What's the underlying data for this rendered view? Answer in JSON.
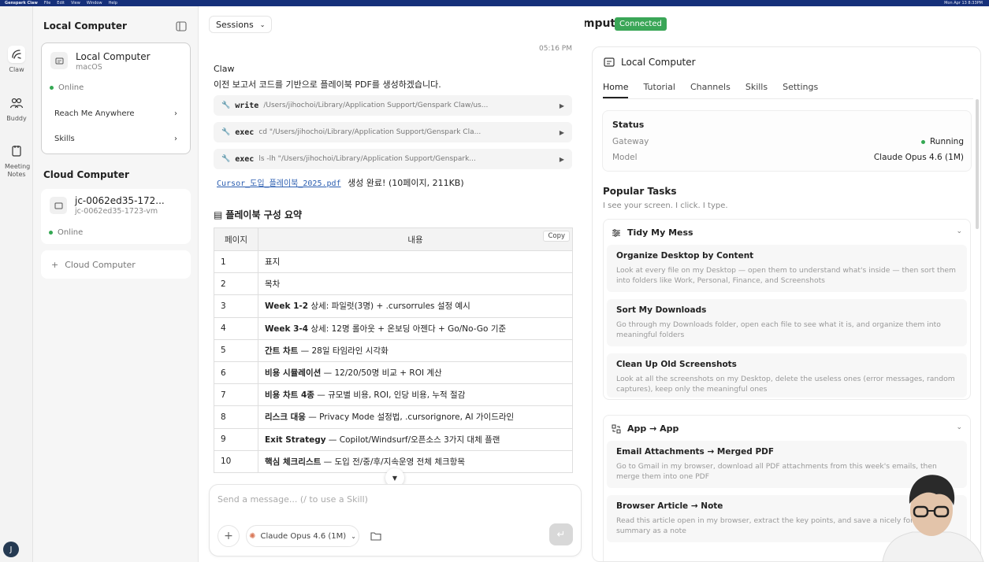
{
  "menubar": {
    "app": "Genspark Claw",
    "items": [
      "File",
      "Edit",
      "View",
      "Window",
      "Help"
    ],
    "clock": "Mon Apr 13 8:33PM"
  },
  "rail": {
    "items": [
      {
        "label": "Claw"
      },
      {
        "label": "Buddy"
      },
      {
        "label": "Meeting Notes"
      }
    ],
    "avatar": "J"
  },
  "left": {
    "local_heading": "Local Computer",
    "local_card": {
      "title": "Local Computer",
      "sub": "macOS",
      "status": "Online"
    },
    "local_rows": [
      "Reach Me Anywhere",
      "Skills"
    ],
    "cloud_heading": "Cloud Computer",
    "cloud_card": {
      "title": "jc-0062ed35-172...",
      "sub": "jc-0062ed35-1723-vm",
      "status": "Online"
    },
    "add_cloud": "Cloud Computer"
  },
  "header": {
    "sessions": "Sessions",
    "title": "Local Computer",
    "badge": "Connected"
  },
  "chat": {
    "time": "05:16 PM",
    "sender": "Claw",
    "intro": "이전 보고서 코드를 기반으로 플레이북 PDF를 생성하겠습니다.",
    "tools": [
      {
        "name": "write",
        "arg": "/Users/jihochoi/Library/Application Support/Genspark Claw/us..."
      },
      {
        "name": "exec",
        "arg": "cd \"/Users/jihochoi/Library/Application Support/Genspark Cla..."
      },
      {
        "name": "exec",
        "arg": "ls -lh \"/Users/jihochoi/Library/Application Support/Genspark..."
      }
    ],
    "result_file": "Cursor_도입_플레이북_2025.pdf",
    "result_text": "생성 완료! (10페이지, 211KB)",
    "summary_heading": "플레이북 구성 요약",
    "copy": "Copy",
    "table": {
      "headers": [
        "페이지",
        "내용"
      ],
      "rows": [
        {
          "page": "1",
          "bold": "",
          "rest": "표지"
        },
        {
          "page": "2",
          "bold": "",
          "rest": "목차"
        },
        {
          "page": "3",
          "bold": "Week 1-2",
          "rest": " 상세: 파일럿(3명) + .cursorrules 설정 예시"
        },
        {
          "page": "4",
          "bold": "Week 3-4",
          "rest": " 상세: 12명 롤아웃 + 온보딩 아젠다 + Go/No-Go 기준"
        },
        {
          "page": "5",
          "bold": "간트 차트",
          "rest": " — 28일 타임라인 시각화"
        },
        {
          "page": "6",
          "bold": "비용 시뮬레이션",
          "rest": " — 12/20/50명 비교 + ROI 계산"
        },
        {
          "page": "7",
          "bold": "비용 차트 4종",
          "rest": " — 규모별 비용, ROI, 인당 비용, 누적 절감"
        },
        {
          "page": "8",
          "bold": "리스크 대응",
          "rest": " — Privacy Mode 설정법, .cursorignore, AI 가이드라인"
        },
        {
          "page": "9",
          "bold": "Exit Strategy",
          "rest": " — Copilot/Windsurf/오픈소스 3가지 대체 플랜"
        },
        {
          "page": "10",
          "bold": "핵심 체크리스트",
          "rest": " — 도입 전/중/후/지속운영 전체 체크항목"
        }
      ]
    },
    "composer": {
      "placeholder": "Send a message... (/ to use a Skill)",
      "model": "Claude Opus 4.6 (1M)"
    }
  },
  "right": {
    "title": "Local Computer",
    "tabs": [
      "Home",
      "Tutorial",
      "Channels",
      "Skills",
      "Settings"
    ],
    "status": {
      "heading": "Status",
      "rows": [
        {
          "label": "Gateway",
          "value": "Running"
        },
        {
          "label": "Model",
          "value": "Claude Opus 4.6 (1M)"
        }
      ]
    },
    "popular_heading": "Popular Tasks",
    "popular_sub": "I see your screen. I click. I type.",
    "groups": [
      {
        "title": "Tidy My Mess",
        "tasks": [
          {
            "title": "Organize Desktop by Content",
            "desc": "Look at every file on my Desktop — open them to understand what's inside — then sort them into folders like Work, Personal, Finance, and Screenshots"
          },
          {
            "title": "Sort My Downloads",
            "desc": "Go through my Downloads folder, open each file to see what it is, and organize them into meaningful folders"
          },
          {
            "title": "Clean Up Old Screenshots",
            "desc": "Look at all the screenshots on my Desktop, delete the useless ones (error messages, random captures), keep only the meaningful ones"
          }
        ]
      },
      {
        "title": "App → App",
        "tasks": [
          {
            "title": "Email Attachments → Merged PDF",
            "desc": "Go to Gmail in my browser, download all PDF attachments from this week's emails, then merge them into one PDF"
          },
          {
            "title": "Browser Article → Note",
            "desc": "Read this article open in my browser, extract the key points, and save a nicely formatted summary as a note"
          }
        ]
      }
    ]
  },
  "colors": {
    "accent_green": "#3aa657",
    "menubar": "#16307a",
    "link": "#2a5db0"
  }
}
